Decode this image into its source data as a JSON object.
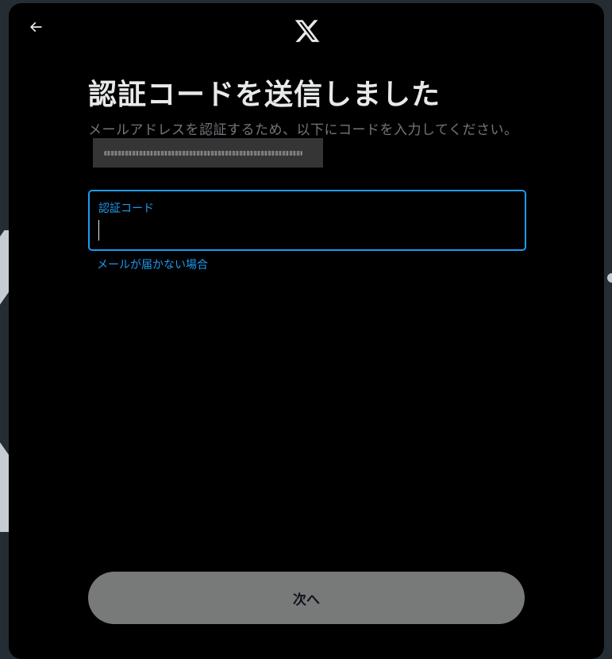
{
  "colors": {
    "backdrop": "#242d34",
    "modal_background": "#000000",
    "title_text": "#e7e9ea",
    "secondary_text": "#71767b",
    "accent": "#1d9bf0",
    "disabled_button": "#787a7a"
  },
  "header": {
    "back_icon": "arrow-left-icon",
    "logo_icon": "x-logo-icon"
  },
  "main": {
    "title": "認証コードを送信しました",
    "subtitle": "メールアドレスを認証するため、以下にコードを入力してください。"
  },
  "code_field": {
    "label": "認証コード",
    "value": ""
  },
  "help_link": "メールが届かない場合",
  "next_button_label": "次へ"
}
